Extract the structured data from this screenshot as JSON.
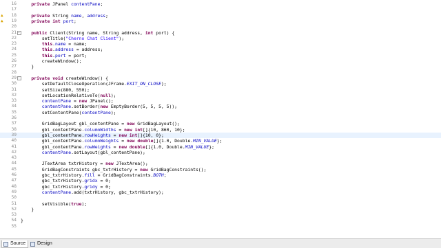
{
  "editor": {
    "current_line": 39,
    "lines": [
      {
        "n": "16",
        "fold": false,
        "warn": false,
        "html": "    <span class='kw'>private</span> JPanel <span class='fd'>contentPane</span>;"
      },
      {
        "n": "17",
        "fold": false,
        "warn": false,
        "html": ""
      },
      {
        "n": "18",
        "fold": false,
        "warn": true,
        "html": "    <span class='kw'>private</span> String <span class='fd'>name</span>, <span class='fd'>address</span>;"
      },
      {
        "n": "19",
        "fold": false,
        "warn": true,
        "html": "    <span class='kw'>private</span> <span class='kw'>int</span> <span class='fd'>port</span>;"
      },
      {
        "n": "20",
        "fold": false,
        "warn": false,
        "html": ""
      },
      {
        "n": "21",
        "fold": true,
        "warn": false,
        "html": "    <span class='kw'>public</span> Client(String name, String address, <span class='kw'>int</span> port) {"
      },
      {
        "n": "22",
        "fold": false,
        "warn": false,
        "html": "        setTitle(<span class='str'>\"Cherno Chat Client\"</span>);"
      },
      {
        "n": "23",
        "fold": false,
        "warn": false,
        "html": "        <span class='kw'>this</span>.<span class='fd'>name</span> = name;"
      },
      {
        "n": "24",
        "fold": false,
        "warn": false,
        "html": "        <span class='kw'>this</span>.<span class='fd'>address</span> = address;"
      },
      {
        "n": "25",
        "fold": false,
        "warn": false,
        "html": "        <span class='kw'>this</span>.<span class='fd'>port</span> = port;"
      },
      {
        "n": "26",
        "fold": false,
        "warn": false,
        "html": "        createWindow();"
      },
      {
        "n": "27",
        "fold": false,
        "warn": false,
        "html": "    }"
      },
      {
        "n": "28",
        "fold": false,
        "warn": false,
        "html": ""
      },
      {
        "n": "29",
        "fold": true,
        "warn": false,
        "html": "    <span class='kw'>private</span> <span class='kw'>void</span> createWindow() {"
      },
      {
        "n": "30",
        "fold": false,
        "warn": false,
        "html": "        setDefaultCloseOperation(JFrame.<span class='st'>EXIT_ON_CLOSE</span>);"
      },
      {
        "n": "31",
        "fold": false,
        "warn": false,
        "html": "        setSize(880, 550);"
      },
      {
        "n": "32",
        "fold": false,
        "warn": false,
        "html": "        setLocationRelativeTo(<span class='kw'>null</span>);"
      },
      {
        "n": "33",
        "fold": false,
        "warn": false,
        "html": "        <span class='fd'>contentPane</span> = <span class='kw'>new</span> JPanel();"
      },
      {
        "n": "34",
        "fold": false,
        "warn": false,
        "html": "        <span class='fd'>contentPane</span>.setBorder(<span class='kw'>new</span> EmptyBorder(5, 5, 5, 5));"
      },
      {
        "n": "35",
        "fold": false,
        "warn": false,
        "html": "        setContentPane(<span class='fd'>contentPane</span>);"
      },
      {
        "n": "36",
        "fold": false,
        "warn": false,
        "html": ""
      },
      {
        "n": "37",
        "fold": false,
        "warn": false,
        "html": "        GridBagLayout gbl_contentPane = <span class='kw'>new</span> GridBagLayout();"
      },
      {
        "n": "38",
        "fold": false,
        "warn": false,
        "html": "        gbl_contentPane.<span class='fd'>columnWidths</span> = <span class='kw'>new</span> <span class='kw'>int</span>[]{10, 860, 10};"
      },
      {
        "n": "39",
        "fold": false,
        "warn": false,
        "html": "        gbl_contentPane.<span class='fd'>rowHeights</span> = <span class='kw'>new</span> <span class='kw'>int</span>[]{10, 0};"
      },
      {
        "n": "40",
        "fold": false,
        "warn": false,
        "html": "        gbl_contentPane.<span class='fd'>columnWeights</span> = <span class='kw'>new</span> <span class='kw'>double</span>[]{1.0, Double.<span class='st'>MIN_VALUE</span>};"
      },
      {
        "n": "41",
        "fold": false,
        "warn": false,
        "html": "        gbl_contentPane.<span class='fd'>rowWeights</span> = <span class='kw'>new</span> <span class='kw'>double</span>[]{1.0, Double.<span class='st'>MIN_VALUE</span>};"
      },
      {
        "n": "42",
        "fold": false,
        "warn": false,
        "html": "        <span class='fd'>contentPane</span>.setLayout(gbl_contentPane);"
      },
      {
        "n": "43",
        "fold": false,
        "warn": false,
        "html": ""
      },
      {
        "n": "44",
        "fold": false,
        "warn": false,
        "html": "        JTextArea txtrHistory = <span class='kw'>new</span> JTextArea();"
      },
      {
        "n": "45",
        "fold": false,
        "warn": false,
        "html": "        GridBagConstraints gbc_txtrHistory = <span class='kw'>new</span> GridBagConstraints();"
      },
      {
        "n": "46",
        "fold": false,
        "warn": false,
        "html": "        gbc_txtrHistory.<span class='fd'>fill</span> = GridBagConstraints.<span class='st'>BOTH</span>;"
      },
      {
        "n": "47",
        "fold": false,
        "warn": false,
        "html": "        gbc_txtrHistory.<span class='fd'>gridx</span> = 0;"
      },
      {
        "n": "48",
        "fold": false,
        "warn": false,
        "html": "        gbc_txtrHistory.<span class='fd'>gridy</span> = 0;"
      },
      {
        "n": "49",
        "fold": false,
        "warn": false,
        "html": "        <span class='fd'>contentPane</span>.add(txtrHistory, gbc_txtrHistory);"
      },
      {
        "n": "50",
        "fold": false,
        "warn": false,
        "html": ""
      },
      {
        "n": "51",
        "fold": false,
        "warn": false,
        "html": "        setVisible(<span class='kw'>true</span>);"
      },
      {
        "n": "52",
        "fold": false,
        "warn": false,
        "html": "    }"
      },
      {
        "n": "53",
        "fold": false,
        "warn": false,
        "html": ""
      },
      {
        "n": "54",
        "fold": false,
        "warn": false,
        "html": "}"
      },
      {
        "n": "55",
        "fold": false,
        "warn": false,
        "html": ""
      }
    ]
  },
  "bottom_tabs": {
    "source_label": "Source",
    "design_label": "Design"
  },
  "colors": {
    "keyword": "#7f0055",
    "field": "#0000c0",
    "string": "#2a00ff",
    "current_line": "#e8f2fe"
  }
}
